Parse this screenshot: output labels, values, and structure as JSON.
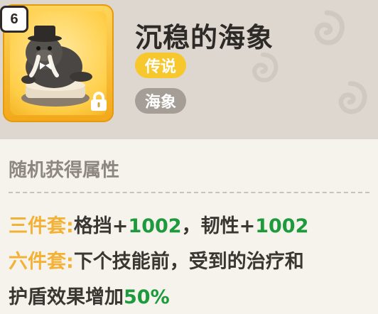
{
  "item": {
    "level": "6",
    "name": "沉稳的海象",
    "rarity": "传说",
    "type": "海象"
  },
  "attributes": {
    "section_title": "随机获得属性",
    "set3": {
      "label": "三件套:",
      "stat1_name": "格挡+",
      "stat1_value": "1002",
      "separator": "，",
      "stat2_name": "韧性+",
      "stat2_value": "1002"
    },
    "set6": {
      "label": "六件套:",
      "text_line1": "下个技能前，受到的治疗和",
      "text_line2": "护盾效果增加",
      "value": "50%"
    }
  },
  "colors": {
    "rarity_badge": "#f7c72e",
    "type_badge": "#a49e96",
    "set_label": "#f3b136",
    "stat_value": "#1d9a3c",
    "card_frame": "#ffc83a"
  },
  "icons": {
    "portrait": "walrus-figure",
    "lock": "lock-icon"
  }
}
